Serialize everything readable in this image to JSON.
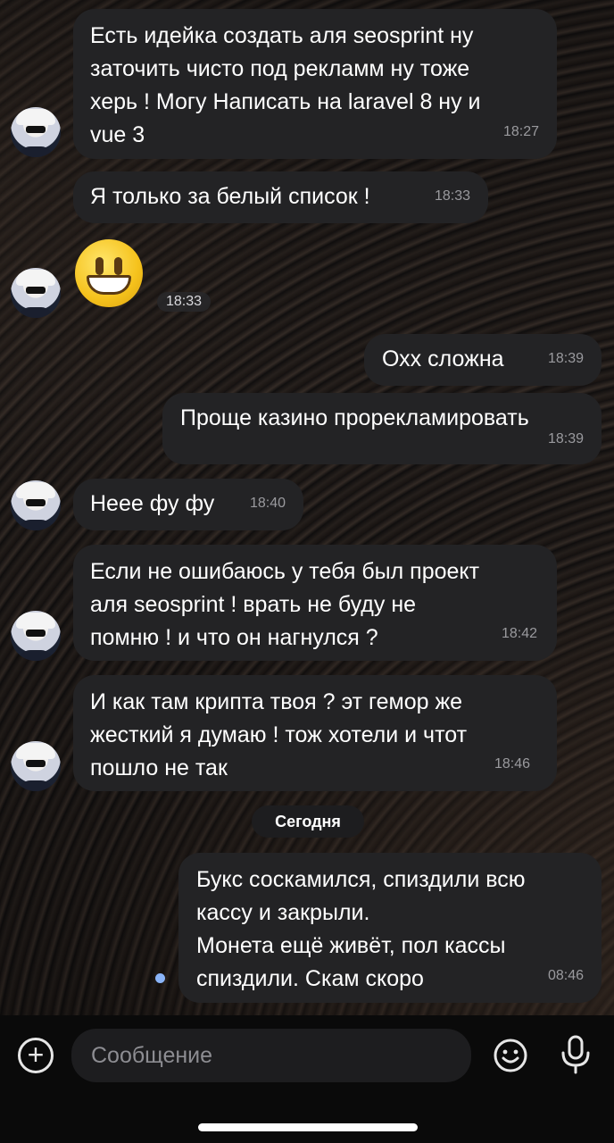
{
  "messages": [
    {
      "text": "Есть идейка создать аля seosprint ну\nзаточить чисто под рекламм ну тоже\nхерь ! Могу Написать на laravel 8 ну и\nvue 3",
      "time": "18:27"
    },
    {
      "text": "Я только за белый список !",
      "time": "18:33"
    },
    {
      "time": "18:33"
    },
    {
      "text": "Охх сложна",
      "time": "18:39"
    },
    {
      "text": "Проще казино прорекламировать",
      "time": "18:39"
    },
    {
      "text": "Неее фу фу",
      "time": "18:40"
    },
    {
      "text": "Если не ошибаюсь у тебя был проект\nаля seosprint ! врать не буду не\nпомню ! и что он нагнулся ?",
      "time": "18:42"
    },
    {
      "text": "И как там крипта твоя ? эт гемор же\nжесткий я думаю ! тож хотели и чтот\nпошло не так",
      "time": "18:46"
    },
    {
      "text": "Букс соскамился, спиздили всю\nкассу и закрыли.\nМонета ещё живёт, пол кассы\nспиздили. Скам скоро",
      "time": "08:46"
    }
  ],
  "date_divider": "Сегодня",
  "composer": {
    "placeholder": "Сообщение",
    "attach_icon": "plus-icon",
    "emoji_icon": "smile-icon",
    "mic_icon": "microphone-icon"
  },
  "colors": {
    "bubble": "#232325",
    "time_text": "#9a9a9e",
    "unread_dot": "#8ab4f8",
    "background": "#0a0909"
  }
}
